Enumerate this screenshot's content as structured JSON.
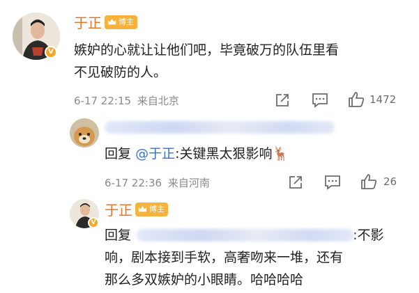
{
  "main_comment": {
    "username": "于正",
    "badge": "博主",
    "text_line1": "嫉妒的心就让让他们吧，毕竟破万的队伍里看",
    "text_line2": "不见破防的人。",
    "date": "6-17 22:15",
    "location": "来自北京",
    "like_count": "1472"
  },
  "reply1": {
    "prefix": "回复",
    "mention": "@于正",
    "text": ":关键黑太狠影响🦌",
    "date": "6-17 22:36",
    "location": "来自河南",
    "like_count": "26"
  },
  "reply2": {
    "username": "于正",
    "badge": "博主",
    "prefix": "回复",
    "text_line1_tail": ":不影",
    "text_line2": "响，剧本接到手软，高奢吻来一堆，还有",
    "text_line3": "那么多双嫉妒的小眼睛。哈哈哈哈"
  },
  "icons": [
    "share-icon",
    "comment-icon",
    "like-icon",
    "verified-icon",
    "crown-icon"
  ],
  "colors": {
    "username": "#e8772e",
    "mention": "#3b73c4",
    "badge": "#f7b23b",
    "meta": "#8a8a8a"
  }
}
